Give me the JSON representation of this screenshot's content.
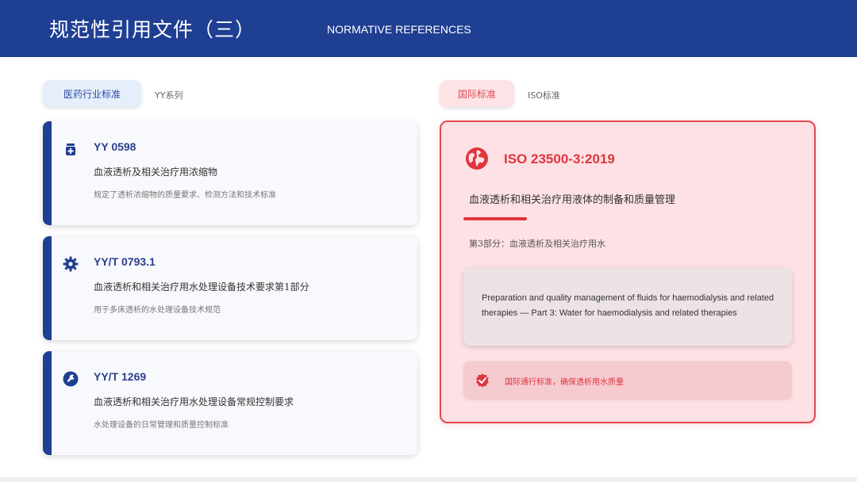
{
  "header": {
    "title": "规范性引用文件（三）",
    "subtitle": "NORMATIVE REFERENCES"
  },
  "left": {
    "pill_label": "医药行业标准",
    "pill_note": "YY系列",
    "cards": [
      {
        "icon": "medicine-bottle-icon",
        "code": "YY 0598",
        "title": "血液透析及相关治疗用浓缩物",
        "desc": "规定了透析浓缩物的质量要求、检测方法和技术标准"
      },
      {
        "icon": "gear-icon",
        "code": "YY/T 0793.1",
        "title": "血液透析和相关治疗用水处理设备技术要求第1部分",
        "desc": "用于多床透析的水处理设备技术规范"
      },
      {
        "icon": "wrench-icon",
        "code": "YY/T 1269",
        "title": "血液透析和相关治疗用水处理设备常规控制要求",
        "desc": "水处理设备的日常管理和质量控制标准"
      }
    ]
  },
  "right": {
    "pill_label": "国际标准",
    "pill_note": "ISO标准",
    "icon": "globe-icon",
    "code": "ISO 23500-3:2019",
    "title": "血液透析和相关治疗用液体的制备和质量管理",
    "part": "第3部分：血液透析及相关治疗用水",
    "english": "Preparation and quality management of fluids for haemodialysis and related therapies — Part 3: Water for haemodialysis and related therapies",
    "note_icon": "check-badge-icon",
    "note": "国际通行标准，确保透析用水质量"
  },
  "colors": {
    "primary_blue": "#1f3f93",
    "accent_red": "#e0353f",
    "iso_card_bg": "#fde1e4"
  }
}
